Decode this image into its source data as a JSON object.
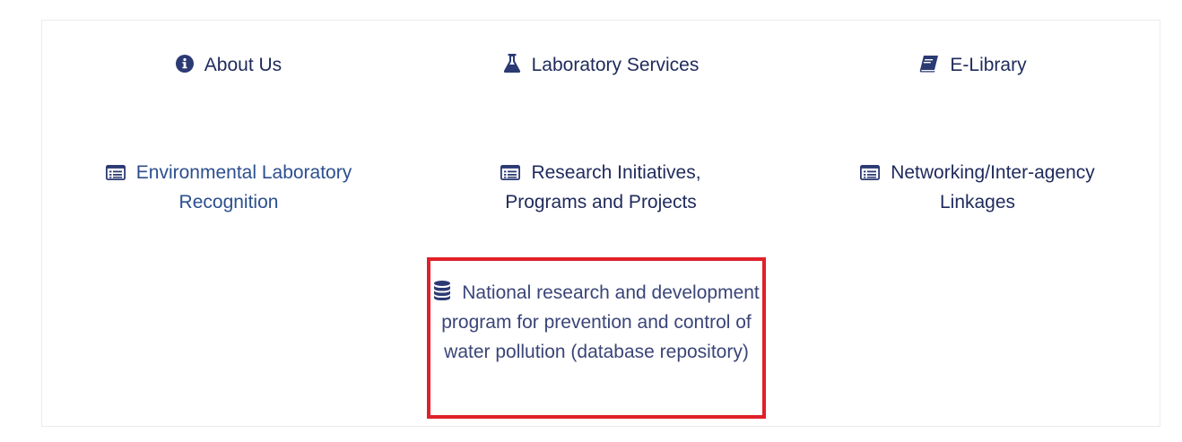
{
  "links": {
    "about": {
      "label": "About Us",
      "icon": "info-circle-icon"
    },
    "lab": {
      "label": "Laboratory Services",
      "icon": "flask-icon"
    },
    "elib": {
      "label": "E-Library",
      "icon": "book-icon"
    },
    "elr": {
      "label": "Environmental Laboratory Recognition",
      "icon": "list-alt-icon"
    },
    "rip": {
      "label": "Research Initiatives, Programs and Projects",
      "icon": "list-alt-icon"
    },
    "nil": {
      "label": "Networking/Inter-agency Linkages",
      "icon": "list-alt-icon"
    },
    "nrdp": {
      "label": "National research and development program for prevention and control of water pollution (database repository)",
      "icon": "database-icon"
    }
  },
  "colors": {
    "text_dark": "#1f2a5c",
    "text_blue": "#2b4f8f",
    "icon": "#2b3a73",
    "highlight_border": "#e0202a"
  }
}
